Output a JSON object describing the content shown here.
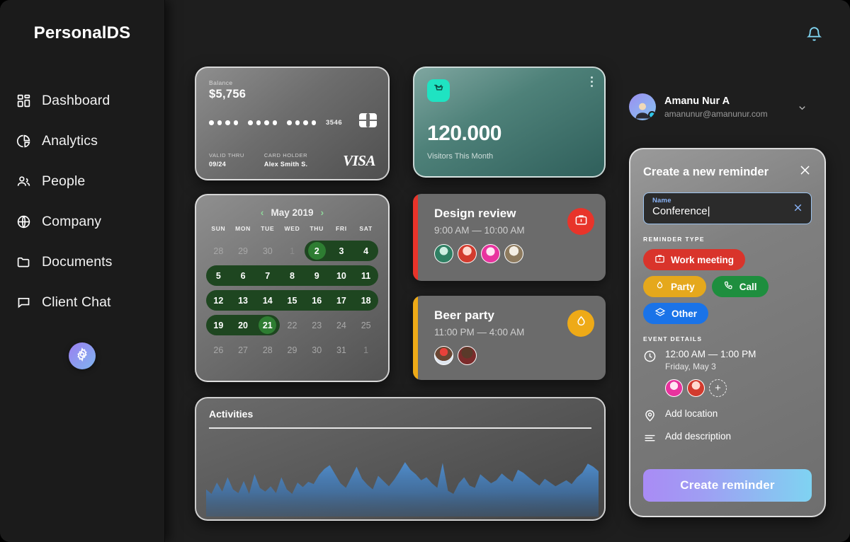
{
  "brand": "PersonalDS",
  "sidebar": {
    "items": [
      {
        "label": "Dashboard",
        "icon": "dashboard-icon"
      },
      {
        "label": "Analytics",
        "icon": "analytics-icon"
      },
      {
        "label": "People",
        "icon": "people-icon"
      },
      {
        "label": "Company",
        "icon": "globe-icon"
      },
      {
        "label": "Documents",
        "icon": "folder-icon"
      },
      {
        "label": "Client Chat",
        "icon": "chat-icon"
      }
    ],
    "settings_icon": "gear-icon"
  },
  "topbar": {
    "notification_icon": "bell-icon",
    "bell_color": "#7fd3ef"
  },
  "credit_card": {
    "balance_label": "Balance",
    "balance": "$5,756",
    "last4": "3546",
    "valid_thru_label": "VALID THRU",
    "valid_thru": "09/24",
    "holder_label": "CARD HOLDER",
    "holder": "Alex Smith S.",
    "network": "VISA"
  },
  "visitors_card": {
    "icon": "cart-icon",
    "icon_color": "#1fe3c2",
    "value": "120.000",
    "caption": "Visitors This Month",
    "menu_icon": "more-vertical-icon"
  },
  "calendar": {
    "month": "May 2019",
    "prev_icon": "chevron-left-icon",
    "next_icon": "chevron-right-icon",
    "dow": [
      "SUN",
      "MON",
      "TUE",
      "WED",
      "THU",
      "FRI",
      "SAT"
    ],
    "rows": [
      [
        "28",
        "29",
        "30",
        "1",
        "2",
        "3",
        "4"
      ],
      [
        "5",
        "6",
        "7",
        "8",
        "9",
        "10",
        "11"
      ],
      [
        "12",
        "13",
        "14",
        "15",
        "16",
        "17",
        "18"
      ],
      [
        "19",
        "20",
        "21",
        "22",
        "23",
        "24",
        "25"
      ],
      [
        "26",
        "27",
        "28",
        "29",
        "30",
        "31",
        "1"
      ]
    ],
    "selected_start": "2",
    "selected_end": "21",
    "highlight_color": "#1e4620",
    "endcap_color": "#2e7d32"
  },
  "events": [
    {
      "title": "Design review",
      "time": "9:00 AM — 10:00 AM",
      "accent": "#e8342a",
      "icon": "briefcase-icon",
      "attendee_count": 4
    },
    {
      "title": "Beer party",
      "time": "11:00 PM — 4:00 AM",
      "accent": "#eeaa17",
      "icon": "drop-icon",
      "attendee_count": 2
    }
  ],
  "activities": {
    "title": "Activities",
    "chart_color": "#4a87c8"
  },
  "chart_data": {
    "type": "area",
    "title": "Activities",
    "xlabel": "",
    "ylabel": "",
    "grid": false,
    "legend": "none",
    "ylim": [
      0,
      100
    ],
    "series": [
      {
        "name": "Activity",
        "values": [
          36,
          30,
          45,
          33,
          52,
          36,
          31,
          47,
          30,
          56,
          38,
          33,
          40,
          31,
          52,
          36,
          30,
          45,
          39,
          46,
          43,
          55,
          63,
          68,
          56,
          44,
          38,
          52,
          66,
          50,
          42,
          36,
          54,
          47,
          40,
          49,
          60,
          72,
          62,
          56,
          48,
          52,
          44,
          38,
          71,
          34,
          30,
          44,
          52,
          41,
          38,
          56,
          50,
          44,
          48,
          57,
          51,
          46,
          62,
          58,
          52,
          46,
          41,
          50,
          45,
          40,
          44,
          48,
          43,
          52,
          58,
          70,
          66,
          60
        ]
      }
    ]
  },
  "profile": {
    "name": "Amanu Nur A",
    "email": "amanunur@amanunur.com",
    "chevron_icon": "chevron-down-icon",
    "avatar": "avatar"
  },
  "reminder": {
    "title": "Create a new reminder",
    "close_icon": "close-icon",
    "name_field": {
      "label": "Name",
      "value": "Conference",
      "placeholder": "Name",
      "clear_icon": "clear-icon"
    },
    "type_section_label": "REMINDER TYPE",
    "types": [
      {
        "label": "Work meeting",
        "color": "#d9342b",
        "icon": "briefcase-icon"
      },
      {
        "label": "Party",
        "color": "#e5a81c",
        "icon": "drop-icon"
      },
      {
        "label": "Call",
        "color": "#1e8e3e",
        "icon": "phone-icon"
      },
      {
        "label": "Other",
        "color": "#1a73e8",
        "icon": "layers-icon"
      }
    ],
    "details_section_label": "EVENT DETAILS",
    "time": "12:00 AM — 1:00 PM",
    "date": "Friday, May 3",
    "clock_icon": "clock-icon",
    "attendee_count": 2,
    "add_attendee_icon": "plus-icon",
    "location_label": "Add location",
    "location_icon": "location-icon",
    "description_label": "Add description",
    "description_icon": "description-icon",
    "submit_label": "Create reminder"
  }
}
